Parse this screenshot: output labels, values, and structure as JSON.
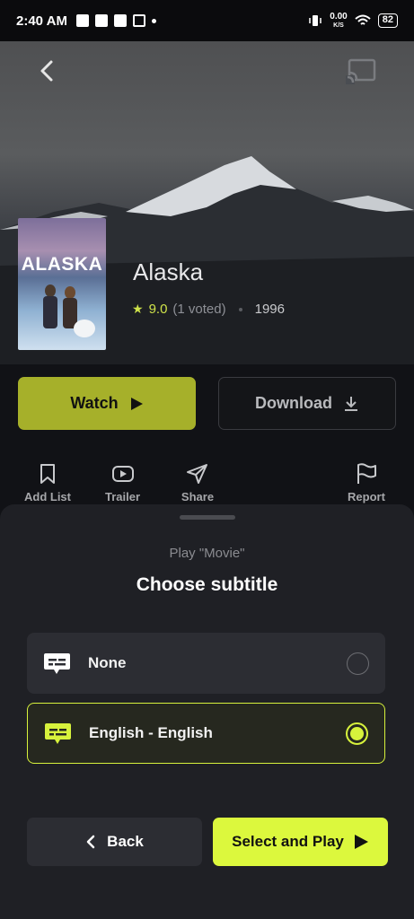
{
  "status_bar": {
    "time": "2:40 AM",
    "speed_value": "0.00",
    "speed_unit": "K/S",
    "battery": "82"
  },
  "movie": {
    "title": "Alaska",
    "poster_title": "ALASKA",
    "rating": "9.0",
    "votes": "(1 voted)",
    "year": "1996"
  },
  "buttons": {
    "watch": "Watch",
    "download": "Download"
  },
  "actions": {
    "add_list": "Add List",
    "trailer": "Trailer",
    "share": "Share",
    "report": "Report"
  },
  "sheet": {
    "subtitle": "Play \"Movie\"",
    "title": "Choose subtitle",
    "options": [
      {
        "label": "None",
        "selected": false
      },
      {
        "label": "English - English",
        "selected": true
      }
    ],
    "back_label": "Back",
    "play_label": "Select and Play"
  },
  "colors": {
    "accent": "#dcf83d",
    "watch_button": "#a6b02a",
    "rating": "#cfe34a"
  }
}
